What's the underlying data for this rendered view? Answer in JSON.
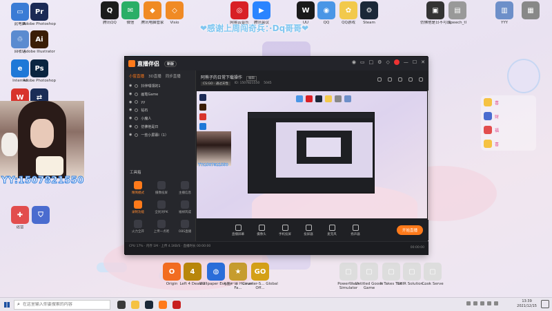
{
  "banner": "❤感谢上周闯奇兵：·Dq哥哥❤",
  "webcam": {
    "id_text": "YY:1507821550"
  },
  "desktop_icons": [
    {
      "label": "此电脑",
      "color": "#3a7bd5",
      "glyph": "▭"
    },
    {
      "label": "Adobe Photoshop",
      "color": "#1b2a55",
      "glyph": "Pr"
    },
    {
      "label": "回收站",
      "color": "#5b8bd0",
      "glyph": "♲"
    },
    {
      "label": "Adobe Illustrator",
      "color": "#3a1d06",
      "glyph": "Ai"
    },
    {
      "label": "Internet",
      "color": "#1e78d7",
      "glyph": "e"
    },
    {
      "label": "Adobe Photoshop",
      "color": "#0a2540",
      "glyph": "Ps"
    },
    {
      "label": "WPS Office",
      "color": "#d8342c",
      "glyph": "W"
    },
    {
      "label": "卡",
      "color": "#1a2d57",
      "glyph": "⇄"
    },
    {
      "label": "腾讯QQ",
      "color": "#1c1c1c",
      "glyph": "Q"
    },
    {
      "label": "微信",
      "color": "#2aae67",
      "glyph": "✉"
    },
    {
      "label": "腾讯电脑管家",
      "color": "#f08a24",
      "glyph": "◆"
    },
    {
      "label": "Visio",
      "color": "#f08a24",
      "glyph": "◇"
    },
    {
      "label": "网易云音乐",
      "color": "#d81f26",
      "glyph": "◎"
    },
    {
      "label": "腾讯会议",
      "color": "#2a84ff",
      "glyph": "▶"
    },
    {
      "label": "UU",
      "color": "#1a1a1a",
      "glyph": "W"
    },
    {
      "label": "QQ",
      "color": "#4a96e6",
      "glyph": "◉"
    },
    {
      "label": "QQ游戏",
      "color": "#f2c94c",
      "glyph": "✿"
    },
    {
      "label": "Steam",
      "color": "#1b2838",
      "glyph": "⚙"
    },
    {
      "label": "仿佛他是日不可战",
      "color": "#333",
      "glyph": "▣"
    },
    {
      "label": "speech_tl",
      "color": "#999",
      "glyph": "▤"
    },
    {
      "label": "YYY",
      "color": "#6d8fc9",
      "glyph": "▥"
    },
    {
      "label": "",
      "color": "#888",
      "glyph": "▦"
    },
    {
      "label": "运营",
      "color": "#e24d4d",
      "glyph": "✚"
    },
    {
      "label": "",
      "color": "#4a6ccf",
      "glyph": "⛉"
    },
    {
      "label": "Origin",
      "color": "#f26c21",
      "glyph": "O"
    },
    {
      "label": "Left 4 Dead 2",
      "color": "#b8860b",
      "glyph": "4"
    },
    {
      "label": "Wallpaper Engine",
      "color": "#2a6dd9",
      "glyph": "◍"
    },
    {
      "label": "人生一串 Human Fa...",
      "color": "#c69c2e",
      "glyph": "★"
    },
    {
      "label": "Counter-S... Global Off...",
      "color": "#d4a017",
      "glyph": "GO"
    },
    {
      "label": "PowerWash Simulator",
      "color": "#ddd",
      "glyph": "▢"
    },
    {
      "label": "Untitled Goose Game",
      "color": "#ddd",
      "glyph": "▢"
    },
    {
      "label": "It Takes Two",
      "color": "#ddd",
      "glyph": "▢"
    },
    {
      "label": "CHIR Solution...",
      "color": "#ddd",
      "glyph": "▢"
    },
    {
      "label": "Cook Serve",
      "color": "#ddd",
      "glyph": "▢"
    }
  ],
  "app": {
    "title": "直播伴侣",
    "badge": "新版",
    "tabs": [
      "小窗直播",
      "3D直播",
      "同步直播"
    ],
    "sources": [
      "抖伴嘿领的1",
      "画笔Game",
      "yy",
      "钻石",
      "小魔人",
      "仿佛他是日",
      "一些小屏幕l（1）"
    ],
    "tools_title": "工具箱",
    "tools": [
      "精简模式",
      "摄像投屏",
      "主播信息",
      "录制功能",
      "全民对PK",
      "福禄风成",
      "火力全开",
      "上传一点吧",
      "OBS直播"
    ],
    "stage_title": "阿熊子的日常下载操作",
    "stage_edit": "编辑",
    "stage_game": "CS:GO · 通过天性",
    "stage_id": "ID: 1507821550",
    "stage_online": "5045",
    "controls": [
      "直播屏幕",
      "摄像头",
      "手机投屏",
      "投屏器",
      "麦克风",
      "扬声器"
    ],
    "go_live": "开始直播",
    "status_left": "CPU 17% · 内存 1M · 上传 4.1KB/S · 直播时长 00:00:00",
    "status_time": "00:00:00"
  },
  "right_panel": [
    "喜",
    "财",
    "福",
    "喜"
  ],
  "taskbar": {
    "search_placeholder": "在这里输入你要搜索的内容",
    "time": "13:39",
    "date": "2021/12/15"
  }
}
